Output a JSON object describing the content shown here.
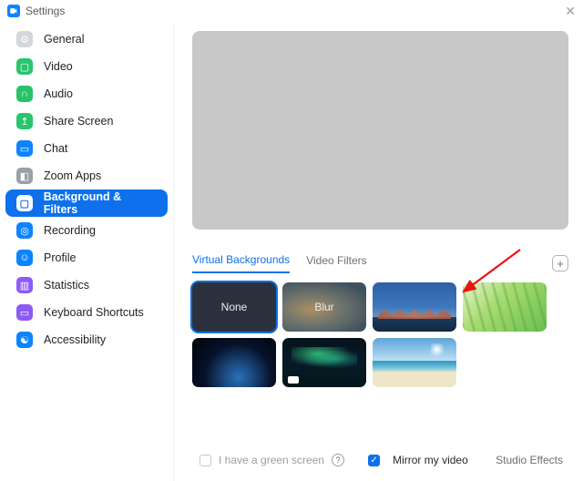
{
  "window": {
    "title": "Settings"
  },
  "sidebar": {
    "items": [
      {
        "label": "General"
      },
      {
        "label": "Video"
      },
      {
        "label": "Audio"
      },
      {
        "label": "Share Screen"
      },
      {
        "label": "Chat"
      },
      {
        "label": "Zoom Apps"
      },
      {
        "label": "Background & Filters"
      },
      {
        "label": "Recording"
      },
      {
        "label": "Profile"
      },
      {
        "label": "Statistics"
      },
      {
        "label": "Keyboard Shortcuts"
      },
      {
        "label": "Accessibility"
      }
    ]
  },
  "tabs": {
    "virtual_backgrounds": "Virtual Backgrounds",
    "video_filters": "Video Filters"
  },
  "thumbs": {
    "none": "None",
    "blur": "Blur"
  },
  "footer": {
    "green_screen": "I have a green screen",
    "mirror": "Mirror my video",
    "studio": "Studio Effects"
  }
}
